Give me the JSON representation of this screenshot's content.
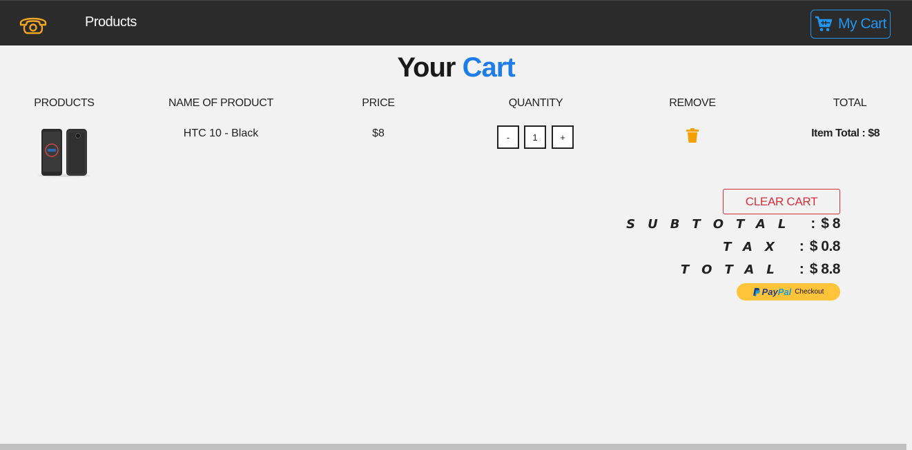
{
  "nav": {
    "logo_icon": "telephone-icon",
    "products_label": "Products",
    "cart_label": "My Cart",
    "cart_icon": "shopping-cart-icon",
    "accent": "#2196f3",
    "logo_color": "#f5a623"
  },
  "page": {
    "title_part1": "Your",
    "title_part2": "Cart",
    "title_accent": "#1e7de6"
  },
  "table": {
    "headers": [
      "products",
      "name of product",
      "price",
      "quantity",
      "remove",
      "total"
    ],
    "rows": [
      {
        "name": "HTC 10 - Black",
        "price": "$8",
        "qty_minus": "-",
        "qty": "1",
        "qty_plus": "+",
        "remove_icon": "trash-icon",
        "item_total": "Item Total : $8"
      }
    ]
  },
  "summary": {
    "clear_label": "clear cart",
    "subtotal_label": "subtotal",
    "subtotal_value": "$ 8",
    "tax_label": "tax",
    "tax_value": "$ 0.8",
    "total_label": "total",
    "total_value": "$ 8.8",
    "clear_color": "#d32f3b"
  },
  "paypal": {
    "pay": "Pay",
    "pal": "Pal",
    "checkout": "Checkout",
    "bg": "#ffc439"
  }
}
